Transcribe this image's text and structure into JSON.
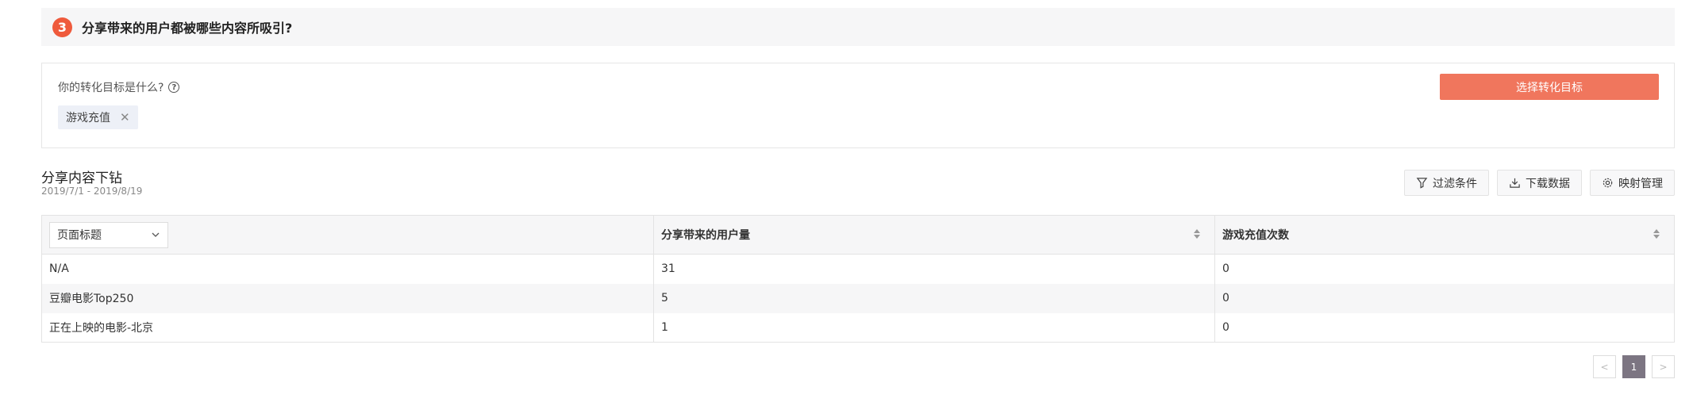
{
  "section": {
    "step": "3",
    "title": "分享带来的用户都被哪些内容所吸引?"
  },
  "goal": {
    "question": "你的转化目标是什么?",
    "help_icon": "question-circle-icon",
    "tag": "游戏充值",
    "select_button": "选择转化目标"
  },
  "table_section": {
    "title": "分享内容下钻",
    "date_range": "2019/7/1 - 2019/8/19"
  },
  "toolbar": {
    "filter_label": "过滤条件",
    "download_label": "下载数据",
    "mapping_label": "映射管理"
  },
  "table": {
    "dimension_select": "页面标题",
    "columns": [
      "分享带来的用户量",
      "游戏充值次数"
    ],
    "rows": [
      [
        "N/A",
        "31",
        "0"
      ],
      [
        "豆瓣电影Top250",
        "5",
        "0"
      ],
      [
        "正在上映的电影-北京",
        "1",
        "0"
      ]
    ]
  },
  "pagination": {
    "prev": "<",
    "current": "1",
    "next": ">"
  },
  "colors": {
    "accent": "#ef5a3c",
    "button": "#f0765d",
    "page_active": "#7c7582"
  }
}
